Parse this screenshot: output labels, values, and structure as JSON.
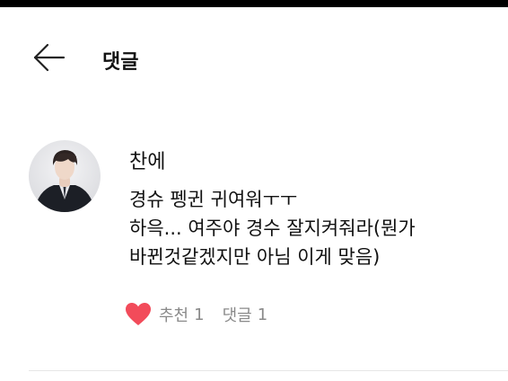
{
  "header": {
    "title": "댓글",
    "back_icon": "arrow-left-icon"
  },
  "comment": {
    "author": "찬에",
    "avatar_icon": "profile-photo",
    "lines": [
      "경슈 펭귄 귀여워ㅜㅜ",
      "하윽...  여주야 경수 잘지켜줘라(뭔가",
      "바뀐것같겠지만 아님 이게 맞음)"
    ],
    "like": {
      "icon": "heart-icon",
      "label": "추천",
      "count": "1"
    },
    "reply": {
      "label": "댓글",
      "count": "1"
    }
  },
  "colors": {
    "status_bar": "#000000",
    "heart": "#f24b5a",
    "meta_text": "#8a8a8a",
    "divider": "#e6e6e6"
  }
}
